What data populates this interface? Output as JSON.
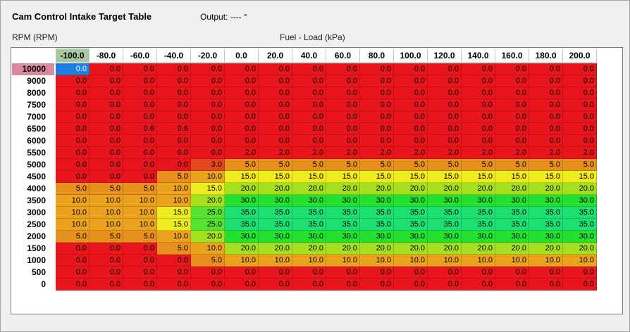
{
  "window": {
    "title": "Cam Control Intake Target Table",
    "output_label": "Output: ---- °"
  },
  "axes": {
    "y_label": "RPM (RPM)",
    "x_label": "Fuel - Load (kPa)"
  },
  "columns": [
    "-100.0",
    "-80.0",
    "-60.0",
    "-40.0",
    "-20.0",
    "0.0",
    "20.0",
    "40.0",
    "60.0",
    "80.0",
    "100.0",
    "120.0",
    "140.0",
    "160.0",
    "180.0",
    "200.0"
  ],
  "rows": [
    "10000",
    "9000",
    "8000",
    "7500",
    "7000",
    "6500",
    "6000",
    "5500",
    "5000",
    "4500",
    "4000",
    "3500",
    "3000",
    "2500",
    "2000",
    "1500",
    "1000",
    "500",
    "0"
  ],
  "active_column": 0,
  "active_row": 0,
  "selected_cell": {
    "row": 0,
    "col": 0
  },
  "colors": {
    "c0": "#e8161c",
    "c2": "#e8161c",
    "c3": "#e4471d",
    "c5": "#e8901e",
    "c10": "#eba21f",
    "c15": "#ecec1f",
    "c20": "#a4e020",
    "c25": "#56e230",
    "c30": "#24e030",
    "c35": "#1ce070",
    "c06": "#e8161c"
  },
  "cells": [
    [
      "0.0",
      "0.0",
      "0.0",
      "0.0",
      "0.0",
      "0.0",
      "0.0",
      "0.0",
      "0.0",
      "0.0",
      "0.0",
      "0.0",
      "0.0",
      "0.0",
      "0.0",
      "0.0"
    ],
    [
      "0.0",
      "0.0",
      "0.0",
      "0.0",
      "0.0",
      "0.0",
      "0.0",
      "0.0",
      "0.0",
      "0.0",
      "0.0",
      "0.0",
      "0.0",
      "0.0",
      "0.0",
      "0.0"
    ],
    [
      "0.0",
      "0.0",
      "0.0",
      "0.0",
      "0.0",
      "0.0",
      "0.0",
      "0.0",
      "0.0",
      "0.0",
      "0.0",
      "0.0",
      "0.0",
      "0.0",
      "0.0",
      "0.0"
    ],
    [
      "0.0",
      "0.0",
      "0.0",
      "0.0",
      "0.0",
      "0.0",
      "0.0",
      "0.0",
      "0.0",
      "0.0",
      "0.0",
      "0.0",
      "0.0",
      "0.0",
      "0.0",
      "0.0"
    ],
    [
      "0.0",
      "0.0",
      "0.0",
      "0.0",
      "0.0",
      "0.0",
      "0.0",
      "0.0",
      "0.0",
      "0.0",
      "0.0",
      "0.0",
      "0.0",
      "0.0",
      "0.0",
      "0.0"
    ],
    [
      "0.0",
      "0.0",
      "0.6",
      "0.6",
      "0.0",
      "0.0",
      "0.0",
      "0.0",
      "0.0",
      "0.0",
      "0.0",
      "0.0",
      "0.0",
      "0.0",
      "0.0",
      "0.0"
    ],
    [
      "0.0",
      "0.0",
      "0.0",
      "0.0",
      "0.0",
      "0.0",
      "0.0",
      "0.0",
      "0.0",
      "0.0",
      "0.0",
      "0.0",
      "0.0",
      "0.0",
      "0.0",
      "0.0"
    ],
    [
      "0.0",
      "0.0",
      "0.0",
      "0.0",
      "0.0",
      "2.0",
      "2.0",
      "2.0",
      "2.0",
      "2.0",
      "2.0",
      "2.0",
      "2.0",
      "2.0",
      "2.0",
      "2.0"
    ],
    [
      "0.0",
      "0.0",
      "0.0",
      "0.0",
      "3.0",
      "5.0",
      "5.0",
      "5.0",
      "5.0",
      "5.0",
      "5.0",
      "5.0",
      "5.0",
      "5.0",
      "5.0",
      "5.0"
    ],
    [
      "0.0",
      "0.0",
      "0.0",
      "5.0",
      "10.0",
      "15.0",
      "15.0",
      "15.0",
      "15.0",
      "15.0",
      "15.0",
      "15.0",
      "15.0",
      "15.0",
      "15.0",
      "15.0"
    ],
    [
      "5.0",
      "5.0",
      "5.0",
      "10.0",
      "15.0",
      "20.0",
      "20.0",
      "20.0",
      "20.0",
      "20.0",
      "20.0",
      "20.0",
      "20.0",
      "20.0",
      "20.0",
      "20.0"
    ],
    [
      "10.0",
      "10.0",
      "10.0",
      "10.0",
      "20.0",
      "30.0",
      "30.0",
      "30.0",
      "30.0",
      "30.0",
      "30.0",
      "30.0",
      "30.0",
      "30.0",
      "30.0",
      "30.0"
    ],
    [
      "10.0",
      "10.0",
      "10.0",
      "15.0",
      "25.0",
      "35.0",
      "35.0",
      "35.0",
      "35.0",
      "35.0",
      "35.0",
      "35.0",
      "35.0",
      "35.0",
      "35.0",
      "35.0"
    ],
    [
      "10.0",
      "10.0",
      "10.0",
      "15.0",
      "25.0",
      "35.0",
      "35.0",
      "35.0",
      "35.0",
      "35.0",
      "35.0",
      "35.0",
      "35.0",
      "35.0",
      "35.0",
      "35.0"
    ],
    [
      "5.0",
      "5.0",
      "5.0",
      "10.0",
      "20.0",
      "30.0",
      "30.0",
      "30.0",
      "30.0",
      "30.0",
      "30.0",
      "30.0",
      "30.0",
      "30.0",
      "30.0",
      "30.0"
    ],
    [
      "0.0",
      "0.0",
      "0.0",
      "5.0",
      "10.0",
      "20.0",
      "20.0",
      "20.0",
      "20.0",
      "20.0",
      "20.0",
      "20.0",
      "20.0",
      "20.0",
      "20.0",
      "20.0"
    ],
    [
      "0.0",
      "0.0",
      "0.0",
      "0.0",
      "5.0",
      "10.0",
      "10.0",
      "10.0",
      "10.0",
      "10.0",
      "10.0",
      "10.0",
      "10.0",
      "10.0",
      "10.0",
      "10.0"
    ],
    [
      "0.0",
      "0.0",
      "0.0",
      "0.0",
      "0.0",
      "0.0",
      "0.0",
      "0.0",
      "0.0",
      "0.0",
      "0.0",
      "0.0",
      "0.0",
      "0.0",
      "0.0",
      "0.0"
    ],
    [
      "0.0",
      "0.0",
      "0.0",
      "0.0",
      "0.0",
      "0.0",
      "0.0",
      "0.0",
      "0.0",
      "0.0",
      "0.0",
      "0.0",
      "0.0",
      "0.0",
      "0.0",
      "0.0"
    ]
  ]
}
